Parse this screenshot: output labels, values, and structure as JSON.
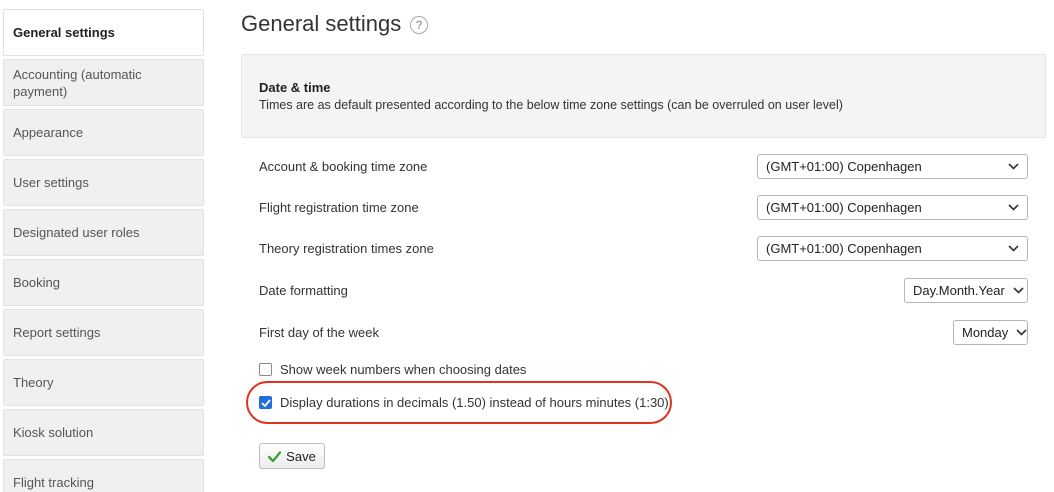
{
  "sidebar": {
    "items": [
      {
        "label": "General settings",
        "active": true
      },
      {
        "label": "Accounting (automatic payment)"
      },
      {
        "label": "Appearance"
      },
      {
        "label": "User settings"
      },
      {
        "label": "Designated user roles"
      },
      {
        "label": "Booking"
      },
      {
        "label": "Report settings"
      },
      {
        "label": "Theory"
      },
      {
        "label": "Kiosk solution"
      },
      {
        "label": "Flight tracking"
      }
    ]
  },
  "page": {
    "title": "General settings",
    "help_icon": "question-circle-icon"
  },
  "date_time": {
    "title": "Date & time",
    "description": "Times are as default presented according to the below time zone settings (can be overruled on user level)"
  },
  "fields": {
    "account_tz": {
      "label": "Account & booking time zone",
      "value": "(GMT+01:00) Copenhagen"
    },
    "flight_tz": {
      "label": "Flight registration time zone",
      "value": "(GMT+01:00) Copenhagen"
    },
    "theory_tz": {
      "label": "Theory registration times zone",
      "value": "(GMT+01:00) Copenhagen"
    },
    "date_format": {
      "label": "Date formatting",
      "value": "Day.Month.Year"
    },
    "first_day": {
      "label": "First day of the week",
      "value": "Monday"
    }
  },
  "checkboxes": {
    "week_numbers": {
      "label": "Show week numbers when choosing dates",
      "checked": false
    },
    "decimals": {
      "label": "Display durations in decimals (1.50) instead of hours minutes (1:30)",
      "checked": true
    }
  },
  "actions": {
    "save_label": "Save",
    "save_icon": "checkmark-icon"
  },
  "colors": {
    "highlight": "#e0331f",
    "checkbox_checked": "#1f6fd6",
    "check_icon": "#3aa335"
  }
}
